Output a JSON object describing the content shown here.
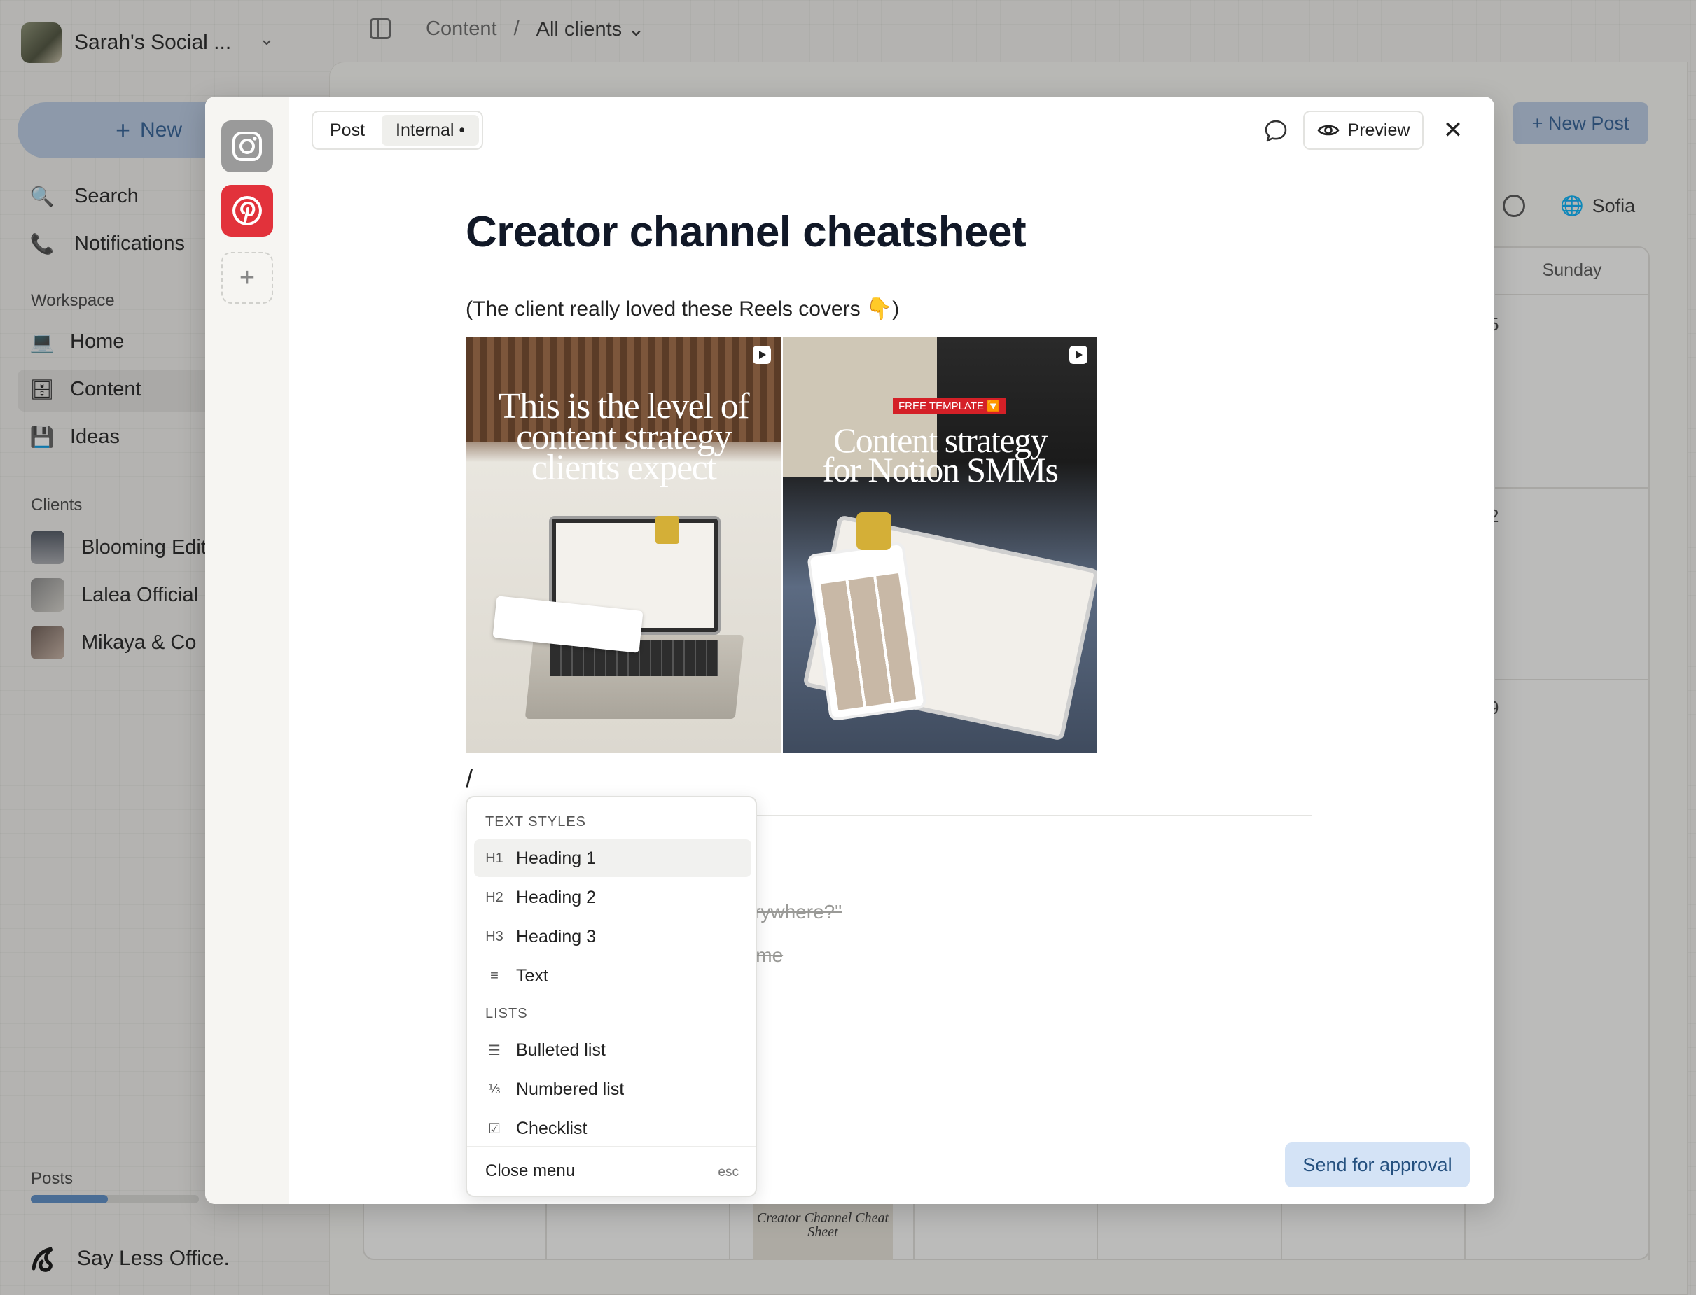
{
  "sidebar": {
    "workspace_name": "Sarah's Social ...",
    "new_label": "New",
    "nav": [
      {
        "label": "Search",
        "icon": "magnifier-icon"
      },
      {
        "label": "Notifications",
        "icon": "phone-icon"
      }
    ],
    "workspace_label": "Workspace",
    "workspace_items": [
      {
        "label": "Home",
        "icon": "laptop-icon"
      },
      {
        "label": "Content",
        "icon": "file-cabinet-icon"
      },
      {
        "label": "Ideas",
        "icon": "floppy-disk-icon"
      }
    ],
    "clients_label": "Clients",
    "clients": [
      {
        "label": "Blooming Edit"
      },
      {
        "label": "Lalea Official"
      },
      {
        "label": "Mikaya & Co"
      }
    ],
    "posts_label": "Posts",
    "posts_progress": 0.46,
    "brand": "Say Less Office."
  },
  "topbar": {
    "crumb_root": "Content",
    "crumb_sep": "/",
    "crumb_current": "All clients"
  },
  "main": {
    "new_post_label": "+ New Post",
    "timezone_label": "Sofia",
    "calendar": {
      "day_header": "Sunday",
      "day_numbers": [
        "5",
        "2",
        "9"
      ],
      "thumb_text": "Creator Channel Cheat Sheet"
    }
  },
  "modal": {
    "tabs": [
      {
        "label": "Post",
        "active": false
      },
      {
        "label": "Internal •",
        "active": true
      }
    ],
    "preview_label": "Preview",
    "close_glyph": "✕",
    "title": "Creator channel cheatsheet",
    "caption": "(The client really loved these Reels covers 👇)",
    "covers": [
      {
        "line1": "This is the level of",
        "line2": "content strategy",
        "line3": "clients expect"
      },
      {
        "badge": "FREE TEMPLATE 🔽",
        "line1": "Content strategy",
        "line2": "for Notion SMMs"
      }
    ],
    "slash_text": "/",
    "ghost_lines": [
      "ng everywhere?\"",
      "eframe"
    ],
    "send_label": "Send for approval"
  },
  "slash_menu": {
    "text_styles_label": "TEXT STYLES",
    "text_styles": [
      {
        "icon": "H1",
        "label": "Heading 1"
      },
      {
        "icon": "H2",
        "label": "Heading 2"
      },
      {
        "icon": "H3",
        "label": "Heading 3"
      },
      {
        "icon": "≡",
        "label": "Text"
      }
    ],
    "lists_label": "LISTS",
    "lists": [
      {
        "icon": "☰",
        "label": "Bulleted list"
      },
      {
        "icon": "⅓",
        "label": "Numbered list"
      },
      {
        "icon": "☑",
        "label": "Checklist"
      }
    ],
    "close_label": "Close menu",
    "close_hint": "esc"
  },
  "colors": {
    "accent_blue": "#5a8bc5",
    "button_blue_bg": "#b9cbe2",
    "pinterest_red": "#e2323b"
  }
}
